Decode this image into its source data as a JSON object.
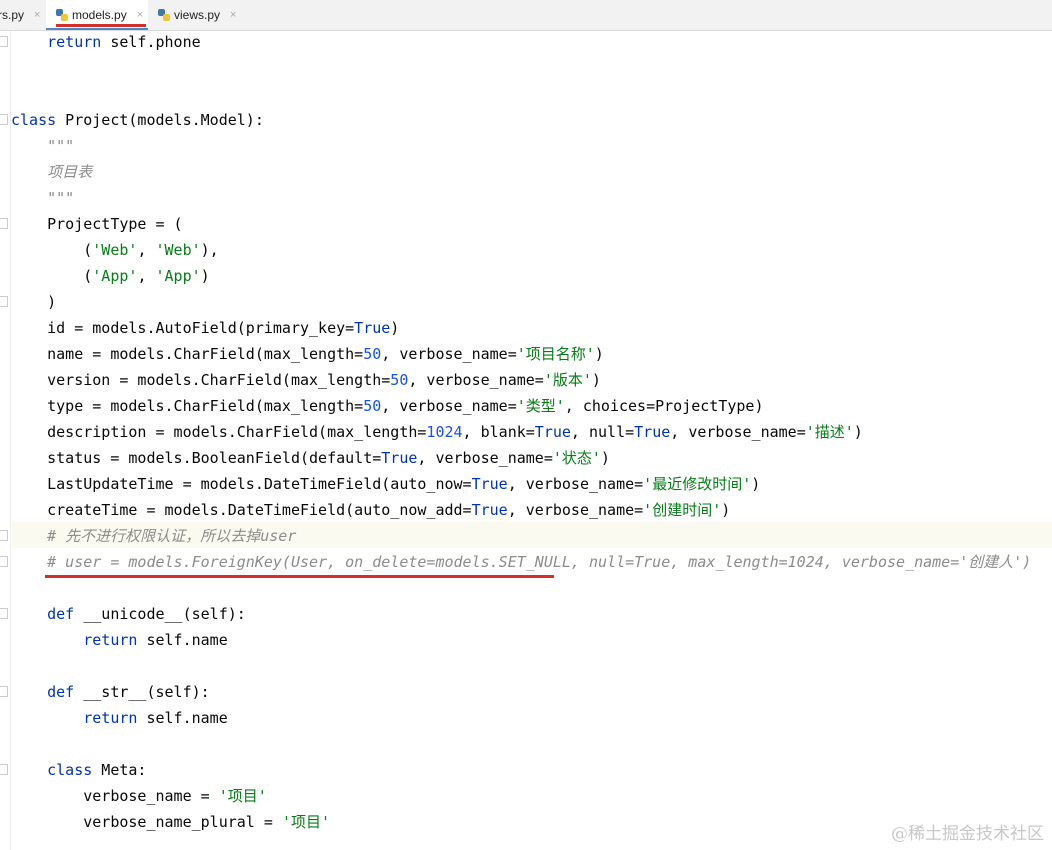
{
  "tabs": [
    {
      "label": "rs.py",
      "icon": "python-file-icon",
      "active": false
    },
    {
      "label": "models.py",
      "icon": "python-file-icon",
      "active": true
    },
    {
      "label": "views.py",
      "icon": "python-file-icon",
      "active": false
    }
  ],
  "close_glyph": "×",
  "code_lines": [
    [
      [
        "p",
        "    "
      ],
      [
        "k",
        "return"
      ],
      [
        "p",
        " self.phone"
      ]
    ],
    [],
    [],
    [
      [
        "k",
        "class"
      ],
      [
        "p",
        " Project(models.Model):"
      ]
    ],
    [
      [
        "p",
        "    "
      ],
      [
        "d",
        "\"\"\""
      ]
    ],
    [
      [
        "p",
        "    "
      ],
      [
        "d",
        "项目表"
      ]
    ],
    [
      [
        "p",
        "    "
      ],
      [
        "d",
        "\"\"\""
      ]
    ],
    [
      [
        "p",
        "    ProjectType = ("
      ]
    ],
    [
      [
        "p",
        "        ("
      ],
      [
        "s",
        "'Web'"
      ],
      [
        "p",
        ", "
      ],
      [
        "s",
        "'Web'"
      ],
      [
        "p",
        "),"
      ]
    ],
    [
      [
        "p",
        "        ("
      ],
      [
        "s",
        "'App'"
      ],
      [
        "p",
        ", "
      ],
      [
        "s",
        "'App'"
      ],
      [
        "p",
        ")"
      ]
    ],
    [
      [
        "p",
        "    )"
      ]
    ],
    [
      [
        "p",
        "    id = models.AutoField(primary_key="
      ],
      [
        "t",
        "True"
      ],
      [
        "p",
        ")"
      ]
    ],
    [
      [
        "p",
        "    name = models.CharField(max_length="
      ],
      [
        "n",
        "50"
      ],
      [
        "p",
        ", verbose_name="
      ],
      [
        "s",
        "'项目名称'"
      ],
      [
        "p",
        ")"
      ]
    ],
    [
      [
        "p",
        "    version = models.CharField(max_length="
      ],
      [
        "n",
        "50"
      ],
      [
        "p",
        ", verbose_name="
      ],
      [
        "s",
        "'版本'"
      ],
      [
        "p",
        ")"
      ]
    ],
    [
      [
        "p",
        "    type = models.CharField(max_length="
      ],
      [
        "n",
        "50"
      ],
      [
        "p",
        ", verbose_name="
      ],
      [
        "s",
        "'类型'"
      ],
      [
        "p",
        ", choices=ProjectType)"
      ]
    ],
    [
      [
        "p",
        "    description = models.CharField(max_length="
      ],
      [
        "n",
        "1024"
      ],
      [
        "p",
        ", blank="
      ],
      [
        "t",
        "True"
      ],
      [
        "p",
        ", null="
      ],
      [
        "t",
        "True"
      ],
      [
        "p",
        ", verbose_name="
      ],
      [
        "s",
        "'描述'"
      ],
      [
        "p",
        ")"
      ]
    ],
    [
      [
        "p",
        "    status = models.BooleanField(default="
      ],
      [
        "t",
        "True"
      ],
      [
        "p",
        ", verbose_name="
      ],
      [
        "s",
        "'状态'"
      ],
      [
        "p",
        ")"
      ]
    ],
    [
      [
        "p",
        "    LastUpdateTime = models.DateTimeField(auto_now="
      ],
      [
        "t",
        "True"
      ],
      [
        "p",
        ", verbose_name="
      ],
      [
        "s",
        "'最近修改时间'"
      ],
      [
        "p",
        ")"
      ]
    ],
    [
      [
        "p",
        "    createTime = models.DateTimeField(auto_now_add="
      ],
      [
        "t",
        "True"
      ],
      [
        "p",
        ", verbose_name="
      ],
      [
        "s",
        "'创建时间'"
      ],
      [
        "p",
        ")"
      ]
    ],
    [
      [
        "p",
        "    "
      ],
      [
        "c",
        "# 先不进行权限认证，所以去掉user"
      ]
    ],
    [
      [
        "p",
        "    "
      ],
      [
        "c",
        "# user = models.ForeignKey(User, on_delete=models.SET_NULL, null=True, max_length=1024, verbose_name='创建人')"
      ]
    ],
    [],
    [
      [
        "p",
        "    "
      ],
      [
        "k",
        "def"
      ],
      [
        "p",
        " __unicode__(self):"
      ]
    ],
    [
      [
        "p",
        "        "
      ],
      [
        "k",
        "return"
      ],
      [
        "p",
        " self.name"
      ]
    ],
    [],
    [
      [
        "p",
        "    "
      ],
      [
        "k",
        "def"
      ],
      [
        "p",
        " __str__(self):"
      ]
    ],
    [
      [
        "p",
        "        "
      ],
      [
        "k",
        "return"
      ],
      [
        "p",
        " self.name"
      ]
    ],
    [],
    [
      [
        "p",
        "    "
      ],
      [
        "k",
        "class"
      ],
      [
        "p",
        " Meta:"
      ]
    ],
    [
      [
        "p",
        "        verbose_name = "
      ],
      [
        "s",
        "'项目'"
      ]
    ],
    [
      [
        "p",
        "        verbose_name_plural = "
      ],
      [
        "s",
        "'项目'"
      ]
    ]
  ],
  "watermark": "@稀土掘金技术社区"
}
